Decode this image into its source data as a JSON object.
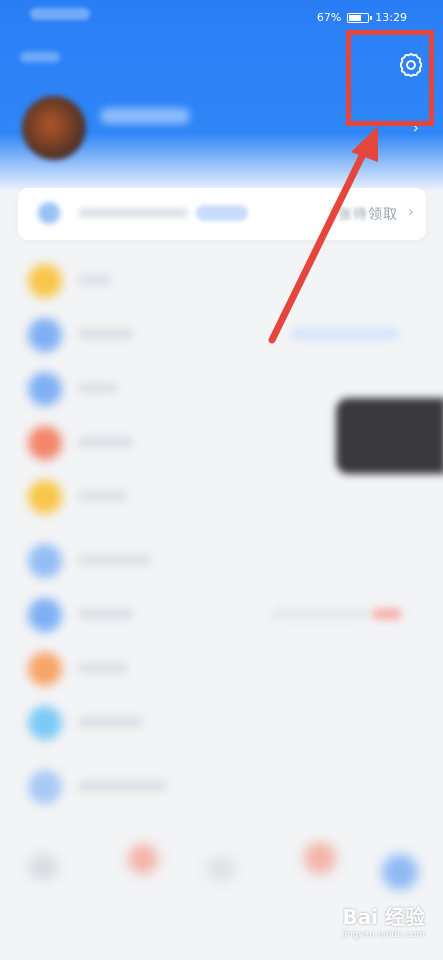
{
  "status_bar": {
    "battery_percent": "67%",
    "time": "13:29"
  },
  "coupon": {
    "action_text_prefix": "1张",
    "action_text_blur": "待",
    "action_text_suffix": "领取"
  },
  "colors": {
    "accent": "#2a7ef5",
    "highlight": "#e4463d"
  },
  "icons": {
    "settings": "gear-icon",
    "chevron": "chevron-right-icon"
  },
  "watermark": {
    "logo": "Bai 经验",
    "url": "jingyan.baidu.com"
  }
}
